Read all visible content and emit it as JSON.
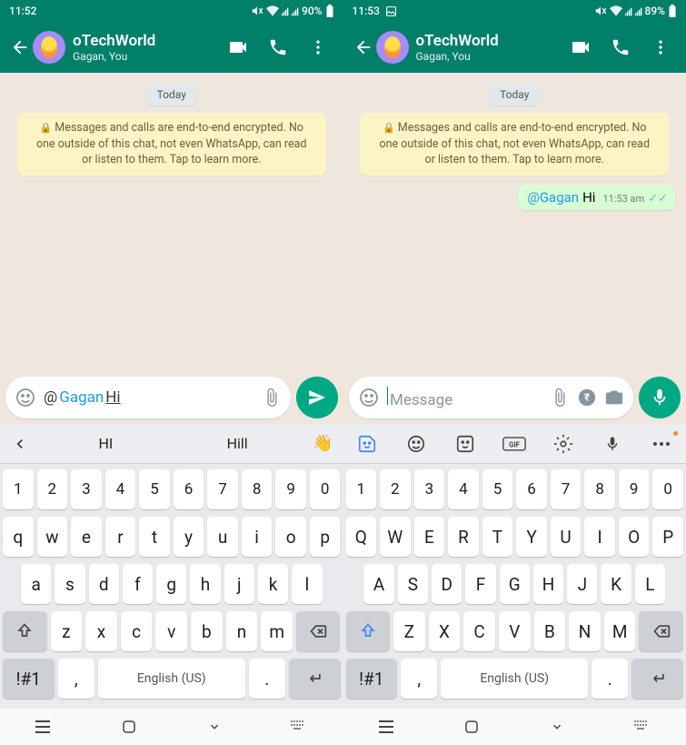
{
  "left": {
    "status": {
      "time": "11:52",
      "battery": "90%"
    },
    "header": {
      "title": "oTechWorld",
      "sub": "Gagan, You"
    },
    "pill": "Today",
    "encrypt": "Messages and calls are end-to-end encrypted. No one outside of this chat, not even WhatsApp, can read or listen to them. Tap to learn more.",
    "input": {
      "at": "@",
      "mention": "Gagan",
      "plain": "Hi"
    },
    "toolbar": {
      "back": "‹",
      "sugg1": "HI",
      "sugg2": "Hill",
      "wave": "👋"
    },
    "keys": {
      "nums": [
        "1",
        "2",
        "3",
        "4",
        "5",
        "6",
        "7",
        "8",
        "9",
        "0"
      ],
      "r1": [
        "q",
        "w",
        "e",
        "r",
        "t",
        "y",
        "u",
        "i",
        "o",
        "p"
      ],
      "r2": [
        "a",
        "s",
        "d",
        "f",
        "g",
        "h",
        "j",
        "k",
        "l"
      ],
      "r3": [
        "z",
        "x",
        "c",
        "v",
        "b",
        "n",
        "m"
      ],
      "sym": "!#1",
      "comma": ",",
      "space": "English (US)",
      "period": "."
    }
  },
  "right": {
    "status": {
      "time": "11:53",
      "battery": "89%"
    },
    "header": {
      "title": "oTechWorld",
      "sub": "Gagan, You"
    },
    "pill": "Today",
    "encrypt": "Messages and calls are end-to-end encrypted. No one outside of this chat, not even WhatsApp, can read or listen to them. Tap to learn more.",
    "msg": {
      "mention": "@Gagan",
      "text": "Hi",
      "time": "11:53 am"
    },
    "input": {
      "placeholder": "Message"
    },
    "toolbar": {
      "gif": "GIF"
    },
    "keys": {
      "nums": [
        "1",
        "2",
        "3",
        "4",
        "5",
        "6",
        "7",
        "8",
        "9",
        "0"
      ],
      "r1": [
        "Q",
        "W",
        "E",
        "R",
        "T",
        "Y",
        "U",
        "I",
        "O",
        "P"
      ],
      "r2": [
        "A",
        "S",
        "D",
        "F",
        "G",
        "H",
        "J",
        "K",
        "L"
      ],
      "r3": [
        "Z",
        "X",
        "C",
        "V",
        "B",
        "N",
        "M"
      ],
      "sym": "!#1",
      "comma": ",",
      "space": "English (US)",
      "period": "."
    }
  }
}
